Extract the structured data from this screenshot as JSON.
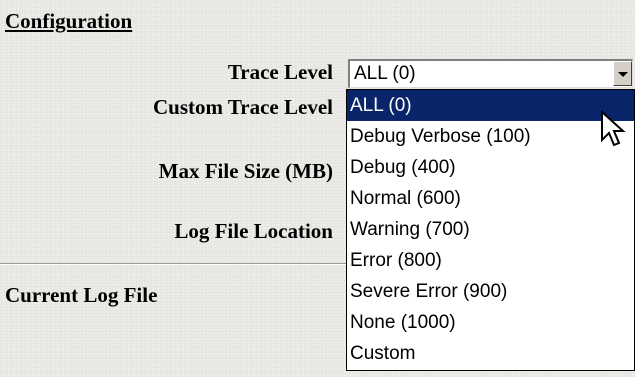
{
  "section_title": "Configuration",
  "labels": {
    "trace_level": "Trace Level",
    "custom_trace_level": "Custom Trace Level",
    "max_file_size": "Max File Size (MB)",
    "log_file_location": "Log File Location",
    "current_log_file": "Current Log File"
  },
  "trace_level_select": {
    "value": "ALL (0)",
    "options": [
      "ALL (0)",
      "Debug Verbose (100)",
      "Debug (400)",
      "Normal (600)",
      "Warning (700)",
      "Error (800)",
      "Severe Error (900)",
      "None (1000)",
      "Custom"
    ],
    "highlighted_option": "ALL (0)"
  },
  "icons": {
    "cursor": "mouse-pointer-arrow",
    "dropdown_arrow": "chevron-down"
  },
  "colors": {
    "selection_background": "#0a246a",
    "selection_text": "#ffffff",
    "page_background": "#eceae6"
  }
}
